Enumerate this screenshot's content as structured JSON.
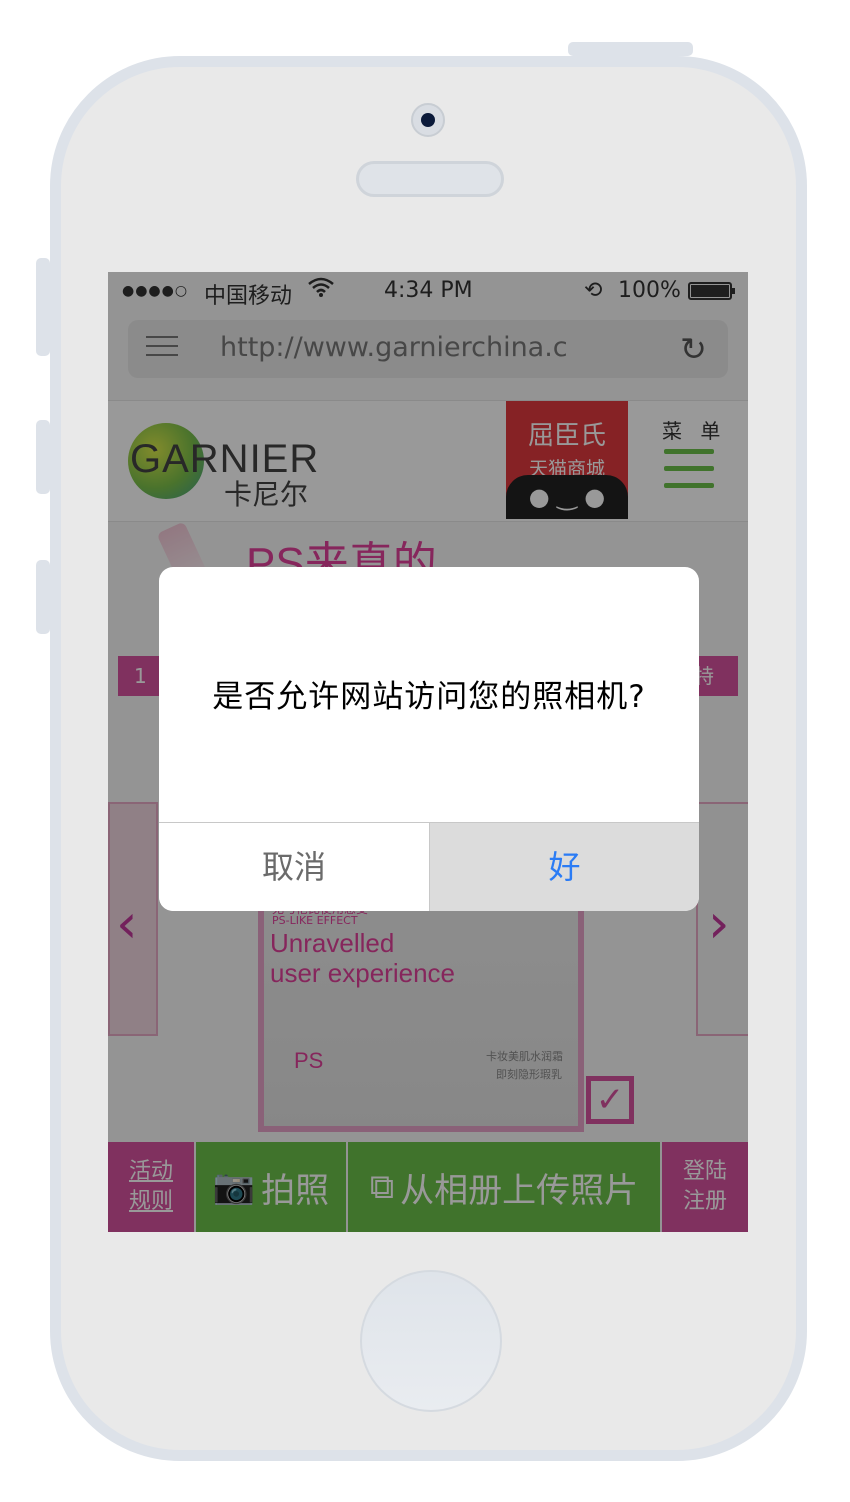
{
  "status_bar": {
    "signal": "●●●●○",
    "carrier": "中国移动",
    "time": "4:34 PM",
    "battery": "100%"
  },
  "browser": {
    "url": "http://www.garnierchina.c",
    "menu_icon": "menu-icon",
    "reload_icon": "reload-icon"
  },
  "site": {
    "logo": "GARNIER",
    "logo_cn": "卡尼尔",
    "tmall_line1": "屈臣氏",
    "tmall_line2": "天猫商城",
    "menu_label": "菜 单",
    "banner_title": "PS来真的",
    "tab_left": "1",
    "tab_right": "特"
  },
  "promo": {
    "cn_line1": "无与伦比使用感受",
    "cn_line2": "PS-LIKE EFFECT",
    "en_line1": "Unravelled",
    "en_line2": "user experience",
    "ps_mark": "PS",
    "caption1": "卡妆美肌水润霜",
    "caption2": "即刻隐形瑕乳"
  },
  "bottom_bar": {
    "rules_line1": "活动",
    "rules_line2": "规则",
    "photo": "拍照",
    "upload": "从相册上传照片",
    "login_line1": "登陆",
    "login_line2": "注册"
  },
  "alert": {
    "message": "是否允许网站访问您的照相机?",
    "cancel": "取消",
    "ok": "好"
  },
  "colors": {
    "accent_pink": "#d6539e",
    "accent_green": "#6cc04a",
    "ios_blue": "#2b7cf5"
  }
}
